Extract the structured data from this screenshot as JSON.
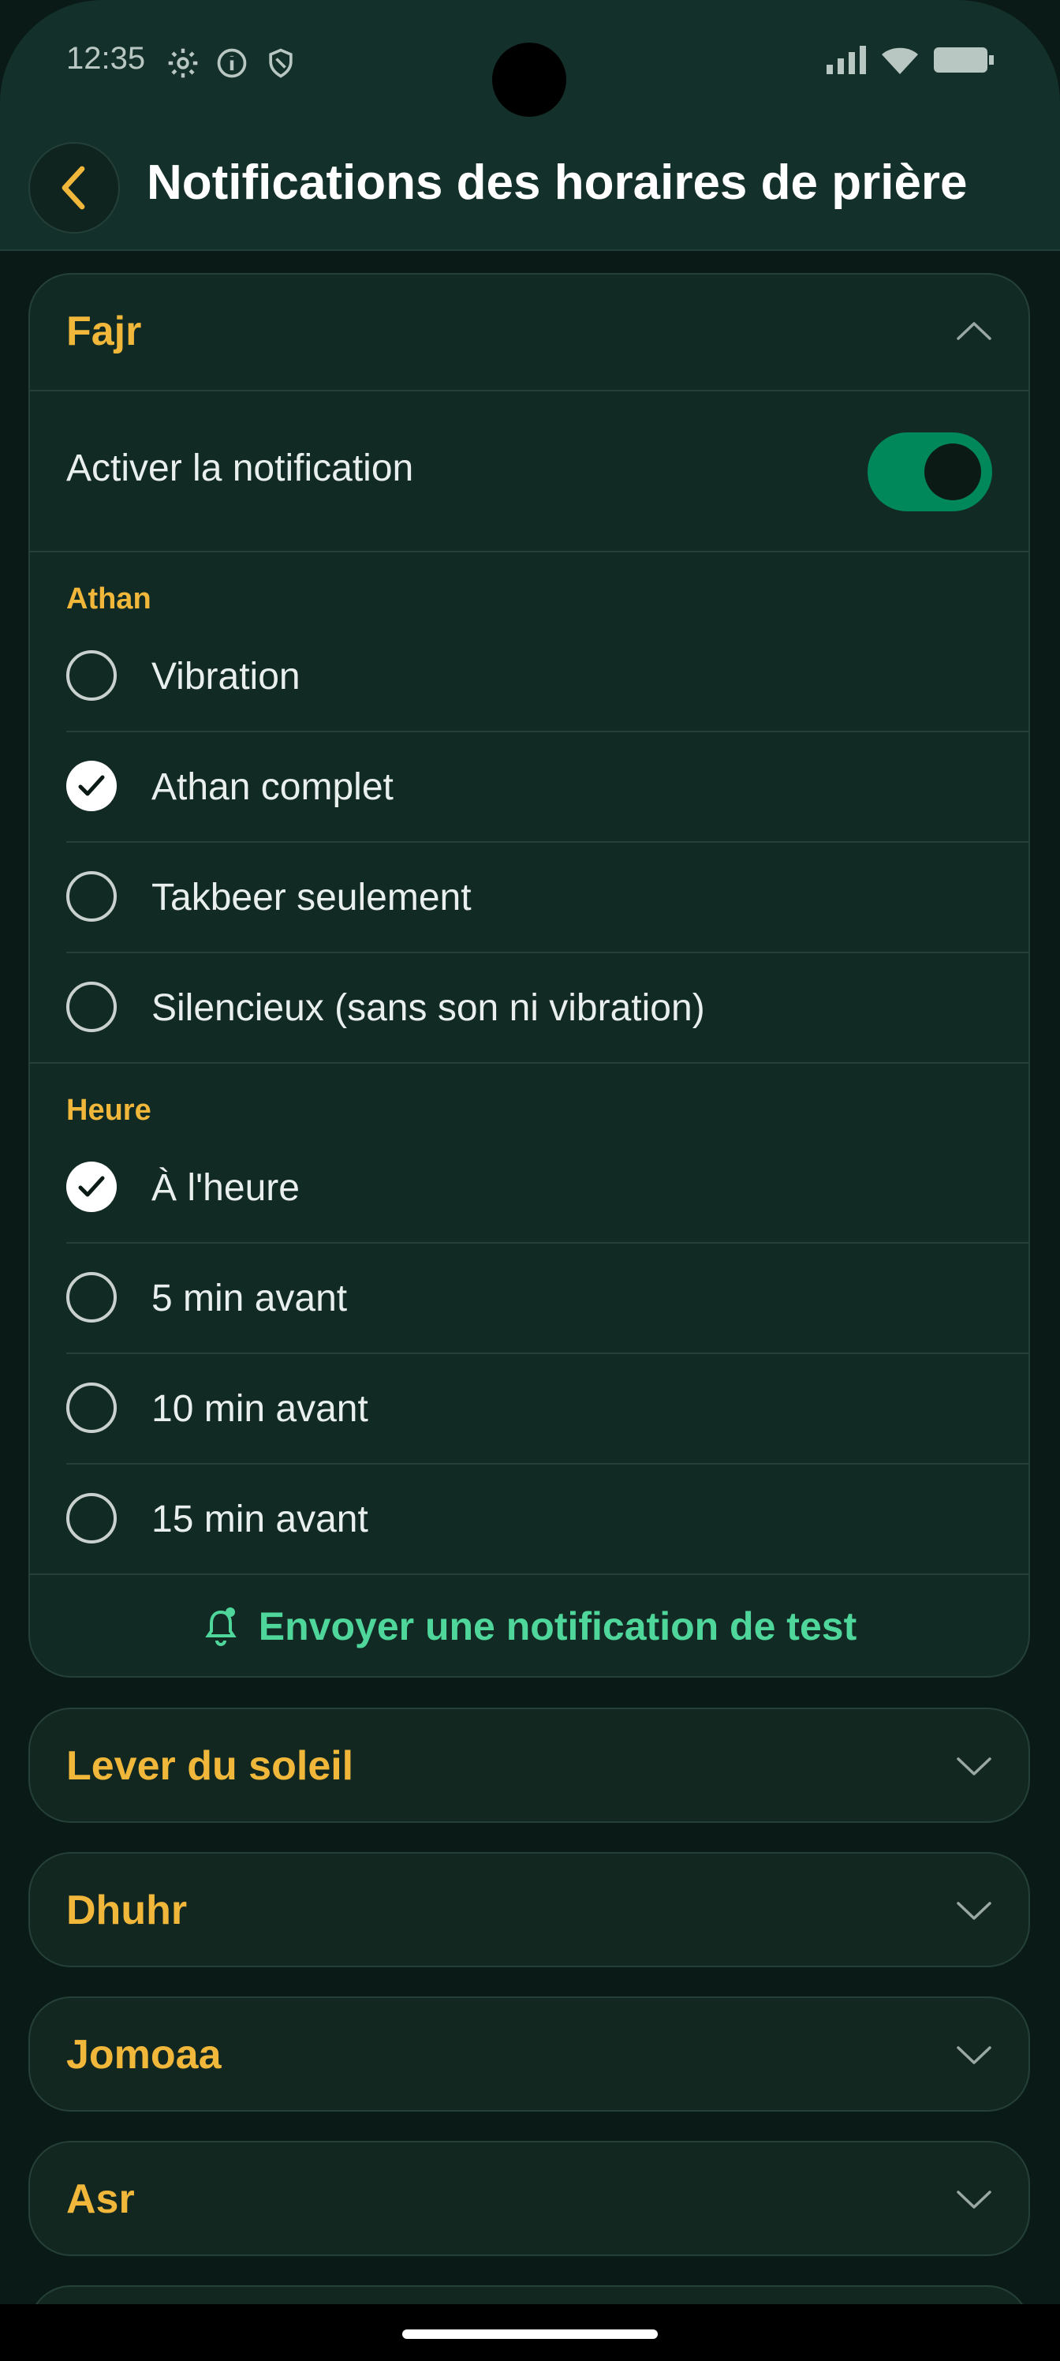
{
  "status_bar": {
    "time": "12:35"
  },
  "header": {
    "title": "Notifications des horaires de prière"
  },
  "fajr": {
    "title": "Fajr",
    "toggle_label": "Activer la notification",
    "enabled": true,
    "athan_label": "Athan",
    "athan_options": [
      {
        "label": "Vibration",
        "selected": false
      },
      {
        "label": "Athan complet",
        "selected": true
      },
      {
        "label": "Takbeer seulement",
        "selected": false
      },
      {
        "label": "Silencieux (sans son ni vibration)",
        "selected": false
      }
    ],
    "time_label": "Heure",
    "time_options": [
      {
        "label": "À l'heure",
        "selected": true
      },
      {
        "label": "5 min avant",
        "selected": false
      },
      {
        "label": "10 min avant",
        "selected": false
      },
      {
        "label": "15 min avant",
        "selected": false
      }
    ],
    "test_button": "Envoyer une notification de test"
  },
  "prayers": [
    {
      "title": "Lever du soleil"
    },
    {
      "title": "Dhuhr"
    },
    {
      "title": "Jomoaa"
    },
    {
      "title": "Asr"
    }
  ],
  "colors": {
    "accent": "#f0b73a",
    "toggle_on": "#00875a",
    "test_button": "#4fd69a",
    "background": "#0a1a16",
    "card": "#122a24"
  }
}
